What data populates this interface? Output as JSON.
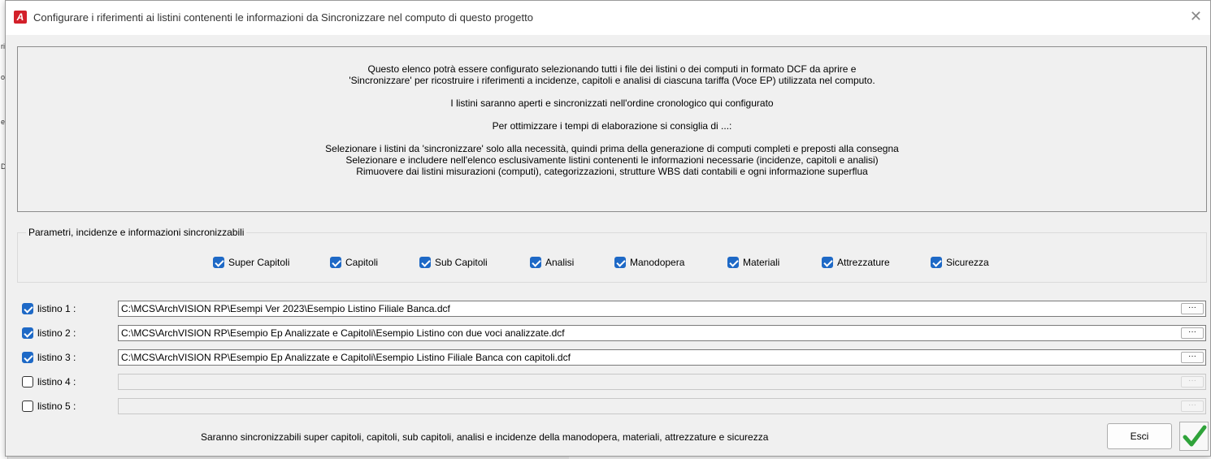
{
  "window": {
    "title": "Configurare i riferimenti ai listini contenenti le informazioni da Sincronizzare nel computo di questo progetto",
    "app_icon_letter": "A",
    "close_glyph": "✕"
  },
  "background_fragments": [
    "ri",
    "o",
    "e",
    "D"
  ],
  "info": {
    "lines": [
      "Questo elenco potrà essere configurato selezionando tutti i file dei listini o dei computi in formato DCF da aprire e",
      "'Sincronizzare' per ricostruire i riferimenti a incidenze, capitoli e analisi di ciascuna tariffa (Voce EP) utilizzata nel computo.",
      "I listini saranno aperti e sincronizzati nell'ordine cronologico qui configurato",
      "Per ottimizzare i tempi di elaborazione si consiglia di ...:",
      "Selezionare i listini da 'sincronizzare' solo alla necessità, quindi prima della generazione di computi completi e preposti alla consegna",
      "Selezionare e includere nell'elenco esclusivamente listini contenenti le informazioni necessarie (incidenze, capitoli e analisi)",
      "Rimuovere dai listini misurazioni (computi), categorizzazioni, strutture WBS dati contabili e ogni informazione superflua"
    ]
  },
  "params": {
    "legend": "Parametri, incidenze e informazioni sincronizzabili",
    "options": [
      {
        "label": "Super Capitoli",
        "checked": true
      },
      {
        "label": "Capitoli",
        "checked": true
      },
      {
        "label": "Sub Capitoli",
        "checked": true
      },
      {
        "label": "Analisi",
        "checked": true
      },
      {
        "label": "Manodopera",
        "checked": true
      },
      {
        "label": "Materiali",
        "checked": true
      },
      {
        "label": "Attrezzature",
        "checked": true
      },
      {
        "label": "Sicurezza",
        "checked": true
      }
    ]
  },
  "listini": [
    {
      "label": "listino 1 :",
      "checked": true,
      "path": "C:\\MCS\\ArchVISION RP\\Esempi Ver 2023\\Esempio Listino Filiale Banca.dcf",
      "browse": "···"
    },
    {
      "label": "listino 2 :",
      "checked": true,
      "path": "C:\\MCS\\ArchVISION RP\\Esempio Ep Analizzate e Capitoli\\Esempio Listino con due voci analizzate.dcf",
      "browse": "···"
    },
    {
      "label": "listino 3 :",
      "checked": true,
      "path": "C:\\MCS\\ArchVISION RP\\Esempio Ep Analizzate e Capitoli\\Esempio Listino Filiale Banca con capitoli.dcf",
      "browse": "···"
    },
    {
      "label": "listino 4 :",
      "checked": false,
      "path": "",
      "browse": "···"
    },
    {
      "label": "listino 5 :",
      "checked": false,
      "path": "",
      "browse": "···"
    }
  ],
  "footer": {
    "summary": "Saranno sincronizzabili super capitoli, capitoli, sub capitoli, analisi e incidenze della manodopera, materiali, attrezzature e sicurezza",
    "esci_label": "Esci"
  },
  "colors": {
    "accent": "#1e69c6",
    "app_icon": "#d3202a",
    "ok_check": "#2fa33a"
  }
}
